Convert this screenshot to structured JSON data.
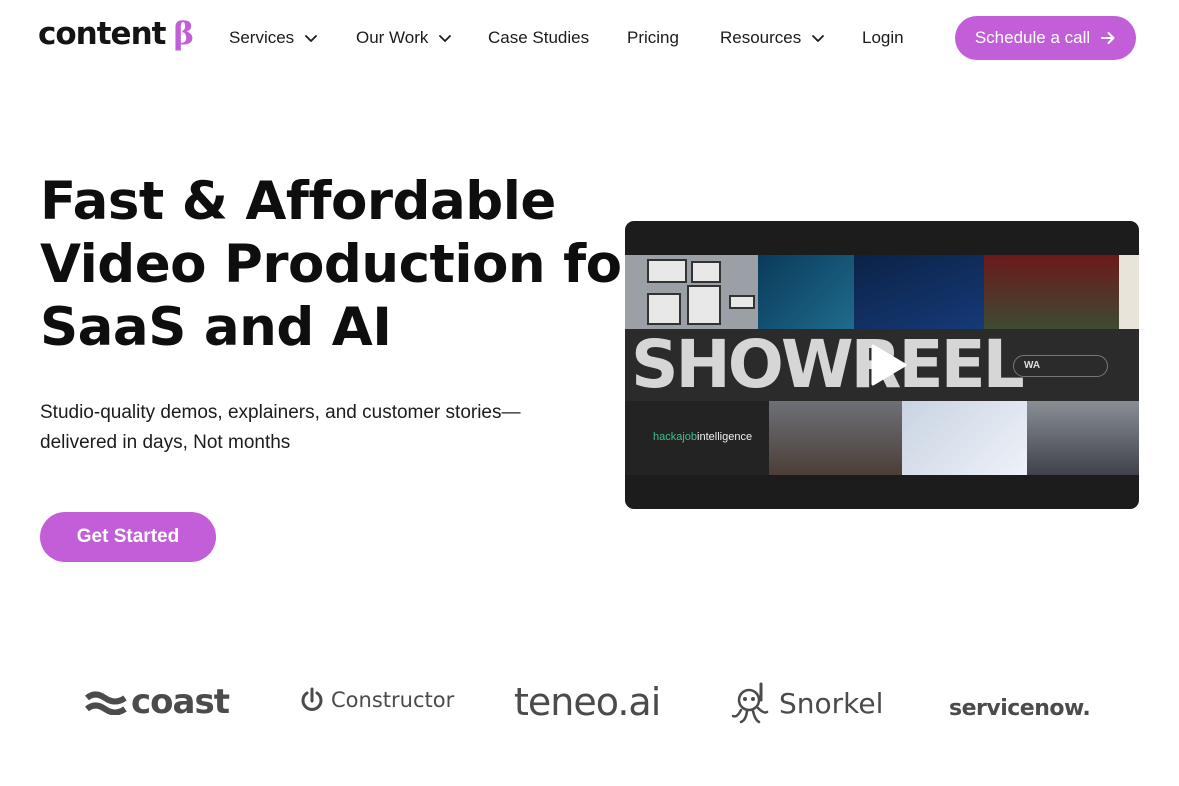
{
  "brand": {
    "logo_word": "content",
    "logo_symbol": "β",
    "accent_color": "#c15ed8"
  },
  "nav": {
    "items": [
      {
        "label": "Services",
        "has_dropdown": true
      },
      {
        "label": "Our Work",
        "has_dropdown": true
      },
      {
        "label": "Case Studies",
        "has_dropdown": false
      },
      {
        "label": "Pricing",
        "has_dropdown": false
      },
      {
        "label": "Resources",
        "has_dropdown": true
      },
      {
        "label": "Login",
        "has_dropdown": false
      }
    ],
    "cta_label": "Schedule a call",
    "cta_icon": "arrow-right-icon"
  },
  "hero": {
    "title_lines": [
      "Fast & Affordable",
      "Video Production for",
      "SaaS and AI"
    ],
    "subtitle_lines": [
      "Studio-quality demos, explainers, and customer stories—",
      "delivered in days, Not months"
    ],
    "button_label": "Get Started"
  },
  "video": {
    "showreel_text": "SHOWREEL",
    "pill_text": "WA",
    "hackajob_brand": "hackajob",
    "hackajob_suffix": "intelligence",
    "play_icon": "play-icon"
  },
  "client_logos": [
    {
      "name": "coast"
    },
    {
      "name": "Constructor"
    },
    {
      "name": "teneo.ai"
    },
    {
      "name": "Snorkel"
    },
    {
      "name": "servicenow."
    }
  ]
}
